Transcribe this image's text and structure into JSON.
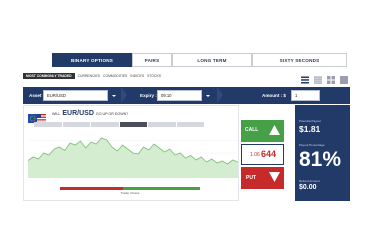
{
  "tabs": [
    {
      "label": "BINARY OPTIONS",
      "active": true
    },
    {
      "label": "PAIRS"
    },
    {
      "label": "LONG TERM"
    },
    {
      "label": "SIXTY SECONDS"
    }
  ],
  "subnav": {
    "active": "MOST COMMONLY TRADED",
    "links": [
      "CURRENCIES",
      "COMMODITIES",
      "INDICES",
      "STOCKS"
    ]
  },
  "toolbar": {
    "asset_label": "Asset :",
    "asset_value": "EUR/USD",
    "expiry_label": "Expiry :",
    "expiry_value": "09:10",
    "amount_label": "Amount : $",
    "amount_value": "1"
  },
  "chart": {
    "question_prefix": "WILL",
    "pair": "EUR/USD",
    "question_suffix": "GO UP OR DOWN?",
    "range_buttons": [
      "",
      "",
      "",
      "",
      "",
      ""
    ],
    "x_ticks": [
      "",
      "",
      "",
      "",
      "",
      "",
      "",
      "",
      ""
    ]
  },
  "sentiment": {
    "left_percent": "",
    "center_label": "Trader Choice",
    "right_percent": "",
    "call_fraction": 0.55
  },
  "trade": {
    "call_label": "CALL",
    "price_prefix": "1.06",
    "price_main": "644",
    "put_label": "PUT"
  },
  "side": {
    "payout_label": "Potential Payout",
    "payout_value": "$1.81",
    "percent_label": "Payout Percentage",
    "percent_value": "81%",
    "refund_label": "Refund Amount",
    "refund_value": "$0.00"
  },
  "colors": {
    "navy": "#223a68",
    "call": "#46a046",
    "put": "#c62a2a",
    "chart_fill": "#d4ecd0"
  },
  "chart_data": {
    "type": "area",
    "x": [
      0,
      1,
      2,
      3,
      4,
      5,
      6,
      7,
      8,
      9,
      10,
      11,
      12,
      13,
      14,
      15,
      16,
      17,
      18,
      19,
      20,
      21,
      22,
      23,
      24,
      25,
      26,
      27,
      28,
      29,
      30,
      31,
      32,
      33,
      34,
      35,
      36,
      37,
      38,
      39,
      40
    ],
    "values": [
      0.35,
      0.42,
      0.38,
      0.5,
      0.46,
      0.58,
      0.62,
      0.55,
      0.7,
      0.66,
      0.74,
      0.6,
      0.72,
      0.68,
      0.8,
      0.76,
      0.62,
      0.54,
      0.66,
      0.58,
      0.5,
      0.48,
      0.62,
      0.56,
      0.68,
      0.6,
      0.52,
      0.58,
      0.46,
      0.5,
      0.4,
      0.45,
      0.36,
      0.42,
      0.32,
      0.38,
      0.3,
      0.34,
      0.28,
      0.36,
      0.32
    ],
    "ylim": [
      0,
      1
    ]
  }
}
